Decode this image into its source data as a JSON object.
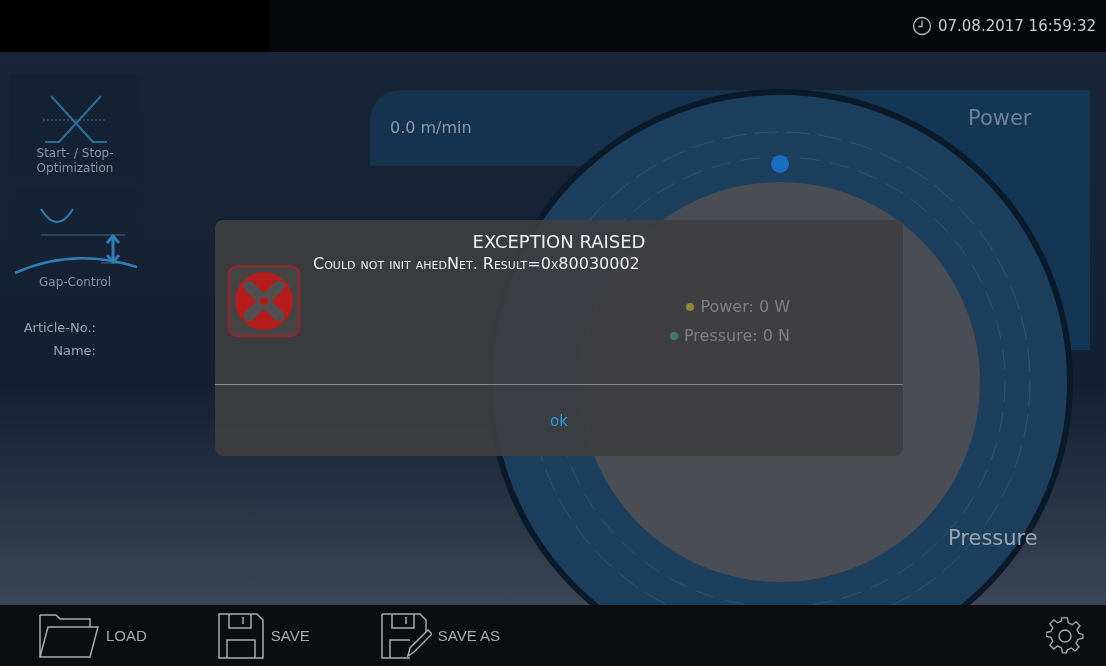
{
  "header": {
    "datetime": "07.08.2017 16:59:32"
  },
  "sidebar": {
    "buttons": [
      {
        "label": "Start- / Stop-Optimization",
        "kind": "optimization"
      },
      {
        "label": "Gap-Control",
        "kind": "gap"
      }
    ],
    "fields": [
      {
        "label": "Article-No.:"
      },
      {
        "label": "Name:"
      }
    ]
  },
  "gauge": {
    "speed": "0.0 m/min",
    "power_label": "Power",
    "pressure_label": "Pressure",
    "legend": [
      {
        "text": "Power: 0 W",
        "color": "#8f8a3a"
      },
      {
        "text": "Pressure: 0 N",
        "color": "#3f7a66"
      }
    ]
  },
  "dialog": {
    "title": "EXCEPTION RAISED",
    "message": "Could not init ahedNet. Result=0x80030002",
    "button": "ok"
  },
  "toolbar": {
    "buttons": [
      {
        "label": "LOAD",
        "kind": "load"
      },
      {
        "label": "SAVE",
        "kind": "save"
      },
      {
        "label": "SAVE AS",
        "kind": "saveas"
      }
    ]
  }
}
